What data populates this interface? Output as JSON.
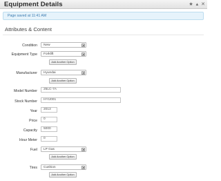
{
  "header": {
    "title": "Equipment Details"
  },
  "notice": {
    "text": "Page saved at 11:41 AM"
  },
  "section": {
    "title": "Attributes & Content"
  },
  "buttons": {
    "add_another": "Add Another Option"
  },
  "fields": {
    "condition": {
      "label": "Condition",
      "value": "New"
    },
    "equipment_type": {
      "label": "Equipment Type",
      "value": "Forklift"
    },
    "manufacturer": {
      "label": "Manufacturer",
      "value": "Hyundai"
    },
    "model_number": {
      "label": "Model Number",
      "value": "25LC-7A"
    },
    "stock_number": {
      "label": "Stock Number",
      "value": "HYU001"
    },
    "year": {
      "label": "Year",
      "value": "2013"
    },
    "price": {
      "label": "Price",
      "value": "0"
    },
    "capacity": {
      "label": "Capacity",
      "value": "5000"
    },
    "hour_meter": {
      "label": "Hour Meter",
      "value": "0"
    },
    "fuel": {
      "label": "Fuel",
      "value": "LP Gas"
    },
    "tires": {
      "label": "Tires",
      "value": "Cushion"
    }
  }
}
